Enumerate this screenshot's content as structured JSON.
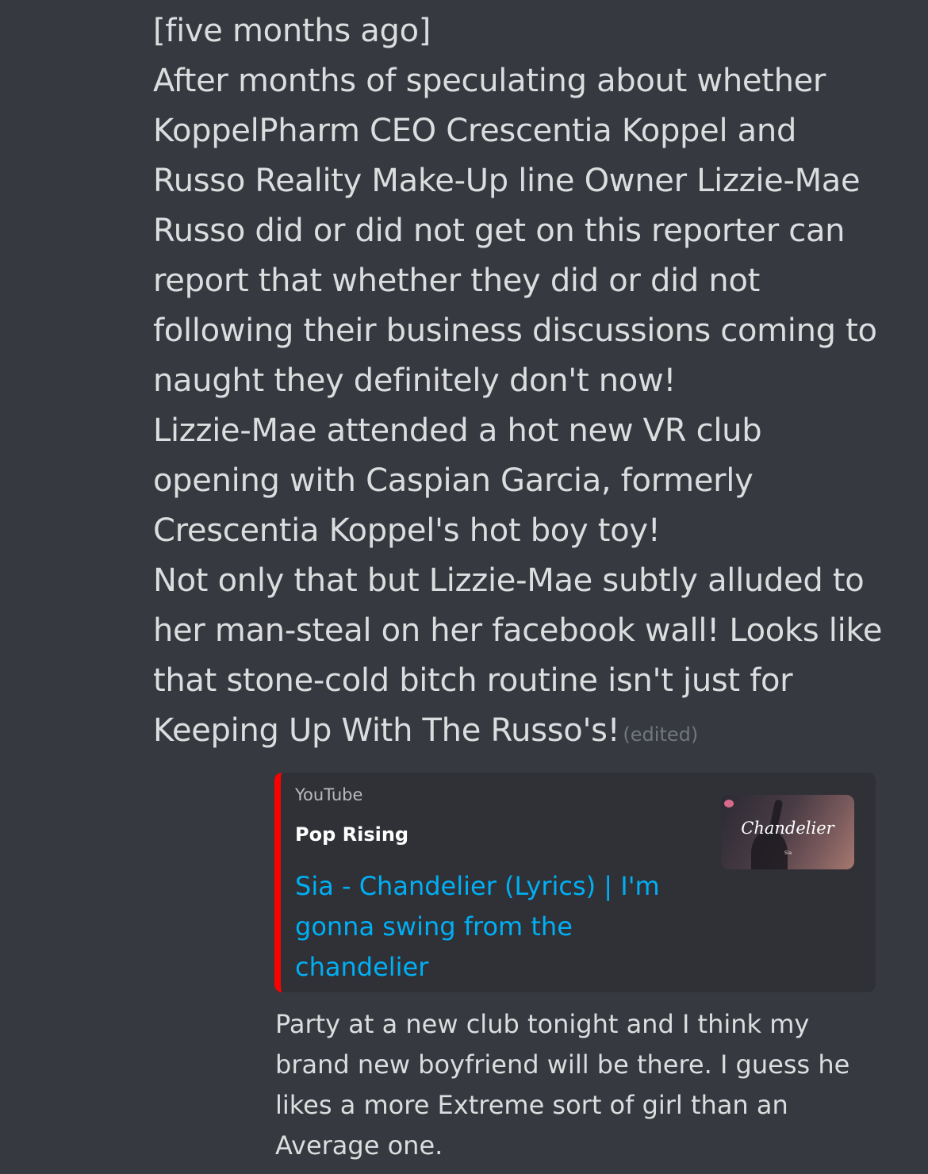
{
  "message": {
    "lines": [
      "[five months ago]",
      "After months of speculating about whether",
      "KoppelPharm CEO Crescentia Koppel and",
      "Russo Reality Make-Up line Owner Lizzie-Mae",
      "Russo did or did not get on this reporter can",
      "report that whether they did or did not",
      "following their business discussions coming to",
      "naught they definitely don't now!",
      "Lizzie-Mae attended a hot new VR club",
      "opening with Caspian Garcia, formerly",
      "Crescentia Koppel's hot boy toy!",
      "Not only that but Lizzie-Mae subtly alluded to",
      "her man-steal on her facebook wall! Looks like",
      "that stone-cold bitch routine isn't just for",
      "Keeping Up With The Russo's!"
    ],
    "edited_label": "(edited)"
  },
  "embed": {
    "accent_color": "#ff0000",
    "provider": "YouTube",
    "author": "Pop Rising",
    "title_lines": [
      "Sia - Chandelier (Lyrics) | I'm",
      "gonna swing from the",
      "chandelier"
    ],
    "thumbnail": {
      "title": "Chandelier",
      "subtitle": "Sia"
    }
  },
  "quote": {
    "lines": [
      "Party at a new club tonight and I think my",
      "brand new boyfriend will be there. I guess he",
      "likes a more Extreme sort of girl than an",
      "Average one."
    ]
  }
}
